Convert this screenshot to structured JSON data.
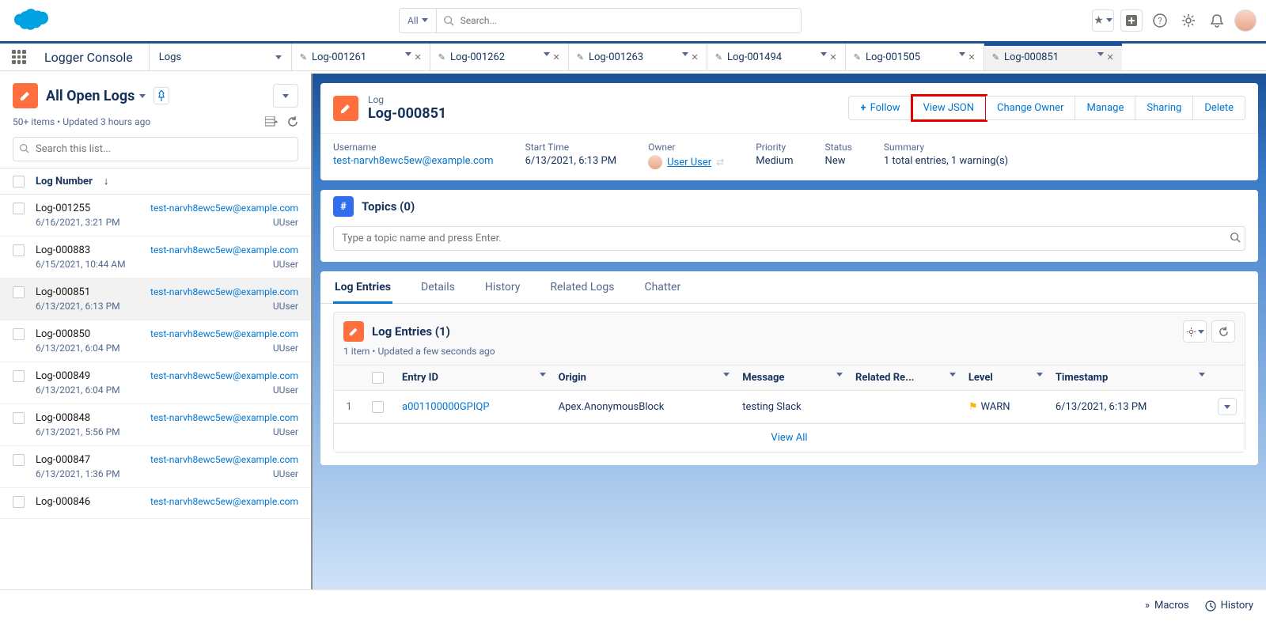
{
  "header": {
    "search_filter": "All",
    "search_placeholder": "Search..."
  },
  "app": {
    "name": "Logger Console",
    "nav_item": "Logs"
  },
  "workspace_tabs": [
    {
      "label": "Log-001261",
      "active": false
    },
    {
      "label": "Log-001262",
      "active": false
    },
    {
      "label": "Log-001263",
      "active": false
    },
    {
      "label": "Log-001494",
      "active": false
    },
    {
      "label": "Log-001505",
      "active": false
    },
    {
      "label": "Log-000851",
      "active": true
    }
  ],
  "list_view": {
    "title": "All Open Logs",
    "sub": "50+ items • Updated 3 hours ago",
    "search_placeholder": "Search this list...",
    "col_header": "Log Number",
    "rows": [
      {
        "num": "Log-001255",
        "email": "test-narvh8ewc5ew@example.com",
        "date": "6/16/2021, 3:21 PM",
        "owner": "UUser",
        "sel": false
      },
      {
        "num": "Log-000883",
        "email": "test-narvh8ewc5ew@example.com",
        "date": "6/15/2021, 10:44 AM",
        "owner": "UUser",
        "sel": false
      },
      {
        "num": "Log-000851",
        "email": "test-narvh8ewc5ew@example.com",
        "date": "6/13/2021, 6:13 PM",
        "owner": "UUser",
        "sel": true
      },
      {
        "num": "Log-000850",
        "email": "test-narvh8ewc5ew@example.com",
        "date": "6/13/2021, 6:04 PM",
        "owner": "UUser",
        "sel": false
      },
      {
        "num": "Log-000849",
        "email": "test-narvh8ewc5ew@example.com",
        "date": "6/13/2021, 6:04 PM",
        "owner": "UUser",
        "sel": false
      },
      {
        "num": "Log-000848",
        "email": "test-narvh8ewc5ew@example.com",
        "date": "6/13/2021, 5:56 PM",
        "owner": "UUser",
        "sel": false
      },
      {
        "num": "Log-000847",
        "email": "test-narvh8ewc5ew@example.com",
        "date": "6/13/2021, 1:36 PM",
        "owner": "UUser",
        "sel": false
      },
      {
        "num": "Log-000846",
        "email": "test-narvh8ewc5ew@example.com",
        "date": "",
        "owner": "",
        "sel": false
      }
    ]
  },
  "record": {
    "object": "Log",
    "name": "Log-000851",
    "actions": {
      "follow": "Follow",
      "view_json": "View JSON",
      "change_owner": "Change Owner",
      "manage": "Manage",
      "sharing": "Sharing",
      "delete": "Delete"
    },
    "fields": {
      "username_label": "Username",
      "username_val": "test-narvh8ewc5ew@example.com",
      "start_label": "Start Time",
      "start_val": "6/13/2021, 6:13 PM",
      "owner_label": "Owner",
      "owner_val": "User User",
      "priority_label": "Priority",
      "priority_val": "Medium",
      "status_label": "Status",
      "status_val": "New",
      "summary_label": "Summary",
      "summary_val": "1 total entries, 1 warning(s)"
    }
  },
  "topics": {
    "title": "Topics (0)",
    "placeholder": "Type a topic name and press Enter."
  },
  "detail_tabs": [
    {
      "label": "Log Entries",
      "active": true
    },
    {
      "label": "Details",
      "active": false
    },
    {
      "label": "History",
      "active": false
    },
    {
      "label": "Related Logs",
      "active": false
    },
    {
      "label": "Chatter",
      "active": false
    }
  ],
  "related": {
    "title": "Log Entries (1)",
    "sub": "1 item • Updated a few seconds ago",
    "columns": [
      "Entry ID",
      "Origin",
      "Message",
      "Related Re...",
      "Level",
      "Timestamp"
    ],
    "rows": [
      {
        "num": "1",
        "entry_id": "a001100000GPIQP",
        "origin": "Apex.AnonymousBlock",
        "message": "testing Slack",
        "related": "",
        "level": "WARN",
        "timestamp": "6/13/2021, 6:13 PM"
      }
    ],
    "view_all": "View All"
  },
  "footer": {
    "macros": "Macros",
    "history": "History"
  }
}
